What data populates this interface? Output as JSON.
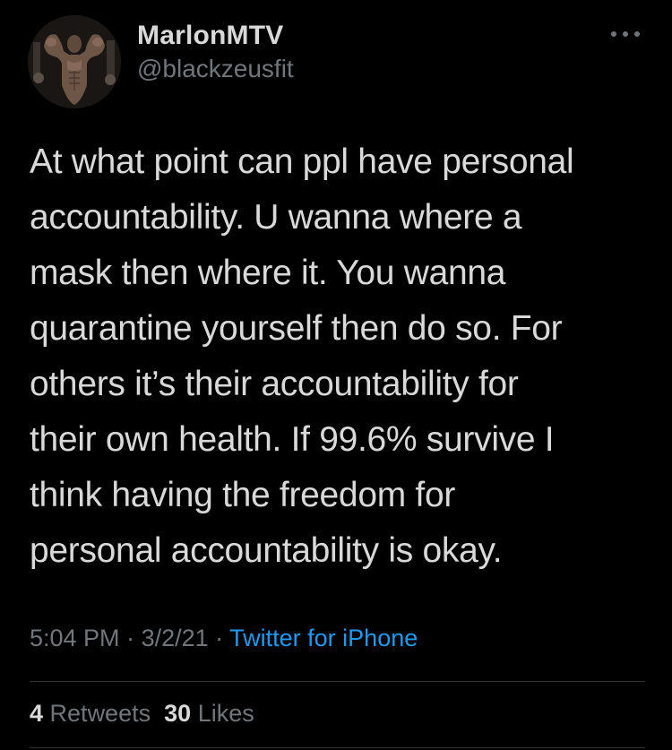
{
  "user": {
    "display_name": "MarlonMTV",
    "handle": "@blackzeusfit",
    "avatar_icon": "profile-avatar"
  },
  "more_icon": "more-horizontal-icon",
  "tweet": {
    "text": "At what point can ppl have personal\naccountability. U wanna where a\nmask then where it. You wanna\nquarantine yourself then do so. For\nothers it’s their accountability for\ntheir own health. If 99.6% survive I\nthink having the freedom for\npersonal accountability is okay."
  },
  "meta": {
    "time": "5:04 PM",
    "separator": " · ",
    "date": "3/2/21",
    "separator2": " · ",
    "source": "Twitter for iPhone"
  },
  "stats": {
    "retweets_count": "4",
    "retweets_label": "Retweets",
    "likes_count": "30",
    "likes_label": "Likes"
  },
  "colors": {
    "background": "#000000",
    "primary_text": "#d9d9d9",
    "secondary_text": "#71767b",
    "link": "#1d9bf0",
    "divider": "#2f3336"
  }
}
